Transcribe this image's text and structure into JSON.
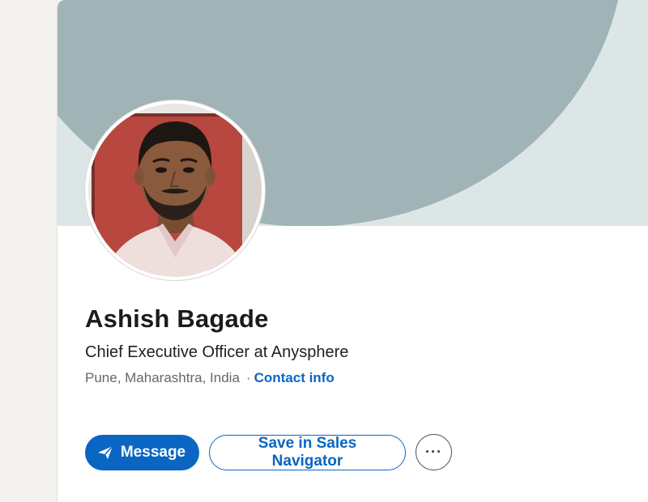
{
  "profile": {
    "name": "Ashish Bagade",
    "headline": "Chief Executive Officer at Anysphere",
    "location": "Pune, Maharashtra, India",
    "separator": "·",
    "contact_info_label": "Contact info",
    "avatar_icon": "profile-photo"
  },
  "actions": {
    "message_label": "Message",
    "message_icon": "send-icon",
    "save_label": "Save in Sales Navigator",
    "more_label": "···",
    "more_icon": "more-horizontal-icon"
  },
  "colors": {
    "primary": "#0a66c2",
    "cover_dark": "#a0b3b7",
    "cover_light": "#dde6e7",
    "page_bg": "#f4f2ee"
  }
}
